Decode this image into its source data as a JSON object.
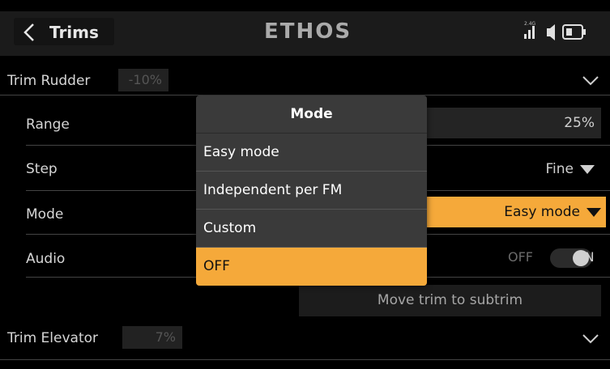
{
  "header": {
    "back_label": "Trims",
    "logo_text": "ETHOS",
    "status_band": "2.4G"
  },
  "trim_rudder": {
    "label": "Trim Rudder",
    "value": "-10%"
  },
  "settings": {
    "range": {
      "label": "Range",
      "value": "25%"
    },
    "step": {
      "label": "Step",
      "value": "Fine"
    },
    "mode": {
      "label": "Mode",
      "value": "Easy mode"
    },
    "audio": {
      "label": "Audio",
      "off_label": "OFF",
      "on_label": "ON",
      "state": "on"
    }
  },
  "move_trim_label": "Move trim to subtrim",
  "trim_elevator": {
    "label": "Trim Elevator",
    "value": "7%"
  },
  "dialog": {
    "title": "Mode",
    "options": [
      "Easy mode",
      "Independent per FM",
      "Custom",
      "OFF"
    ],
    "selected_index": 3
  },
  "colors": {
    "accent": "#f5a93a",
    "background": "#000000",
    "header": "#1b1b1b",
    "dialog": "#3a3a3a"
  },
  "icons": [
    "chevron-left-icon",
    "chevron-down-icon",
    "signal-icon",
    "speaker-icon",
    "battery-icon",
    "dropdown-triangle-icon"
  ]
}
